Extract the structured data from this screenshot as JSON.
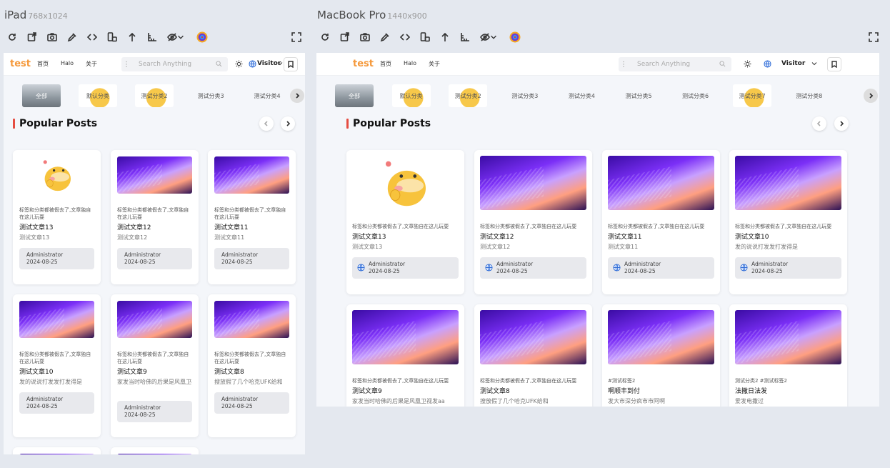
{
  "devices": {
    "ipad": {
      "name": "iPad",
      "dims": "768x1024"
    },
    "macbook": {
      "name": "MacBook Pro",
      "dims": "1440x900"
    }
  },
  "toolbar_icons": [
    "refresh-icon",
    "screenshot-edit-icon",
    "camera-icon",
    "eyedropper-icon",
    "code-icon",
    "device-rotate-icon",
    "arrow-up-icon",
    "ruler-icon",
    "eye-off-icon",
    "chevron-down-icon",
    "color-wheel-icon"
  ],
  "site": {
    "logo": "test",
    "nav": [
      "首页",
      "Halo",
      "关于"
    ],
    "search_placeholder": "Search Anything",
    "visitor": "Visitor"
  },
  "categories": [
    "全部",
    "默认分类",
    "测试分类2",
    "测试分类3",
    "测试分类4",
    "测试分类5",
    "测试分类6",
    "测试分类7",
    "测试分类8"
  ],
  "section_title": "Popular Posts",
  "posts": [
    {
      "tags": "标签和分类都被假去了,文章独自在这儿玩耍",
      "title": "测试文章13",
      "excerpt": "测试文章13",
      "author": "Administrator",
      "date": "2024-08-25",
      "image": "duck"
    },
    {
      "tags": "标签和分类都被假去了,文章独自在这儿玩耍",
      "title": "测试文章12",
      "excerpt": "测试文章12",
      "author": "Administrator",
      "date": "2024-08-25",
      "image": "laptop"
    },
    {
      "tags": "标签和分类都被假去了,文章独自在这儿玩耍",
      "title": "测试文章11",
      "excerpt": "测试文章11",
      "author": "Administrator",
      "date": "2024-08-25",
      "image": "laptop"
    },
    {
      "tags": "标签和分类都被假去了,文章独自在这儿玩耍",
      "title": "测试文章10",
      "excerpt": "发的说说打发发打发得是",
      "author": "Administrator",
      "date": "2024-08-25",
      "image": "laptop"
    },
    {
      "tags": "标签和分类都被假去了,文章独自在这儿玩耍",
      "title": "测试文章9",
      "excerpt": "家发当时哈佛的后果是风凰卫视发aa",
      "author": "Administrator",
      "date": "2024-08-25",
      "image": "laptop"
    },
    {
      "tags": "标签和分类都被假去了,文章独自在这儿玩耍",
      "title": "测试文章8",
      "excerpt": "搜放假了几个哈克UFK给和",
      "author": "Administrator",
      "date": "2024-08-25",
      "image": "laptop"
    }
  ],
  "mac_extra_posts": [
    {
      "tags": "#测试标签2",
      "title": "啊顺丰到付",
      "excerpt": "发大市深分疯市市阿啊"
    },
    {
      "tags": "测试分类2  #测试标签2",
      "title": "法撒日法发",
      "excerpt": "爱发电撒过"
    }
  ]
}
